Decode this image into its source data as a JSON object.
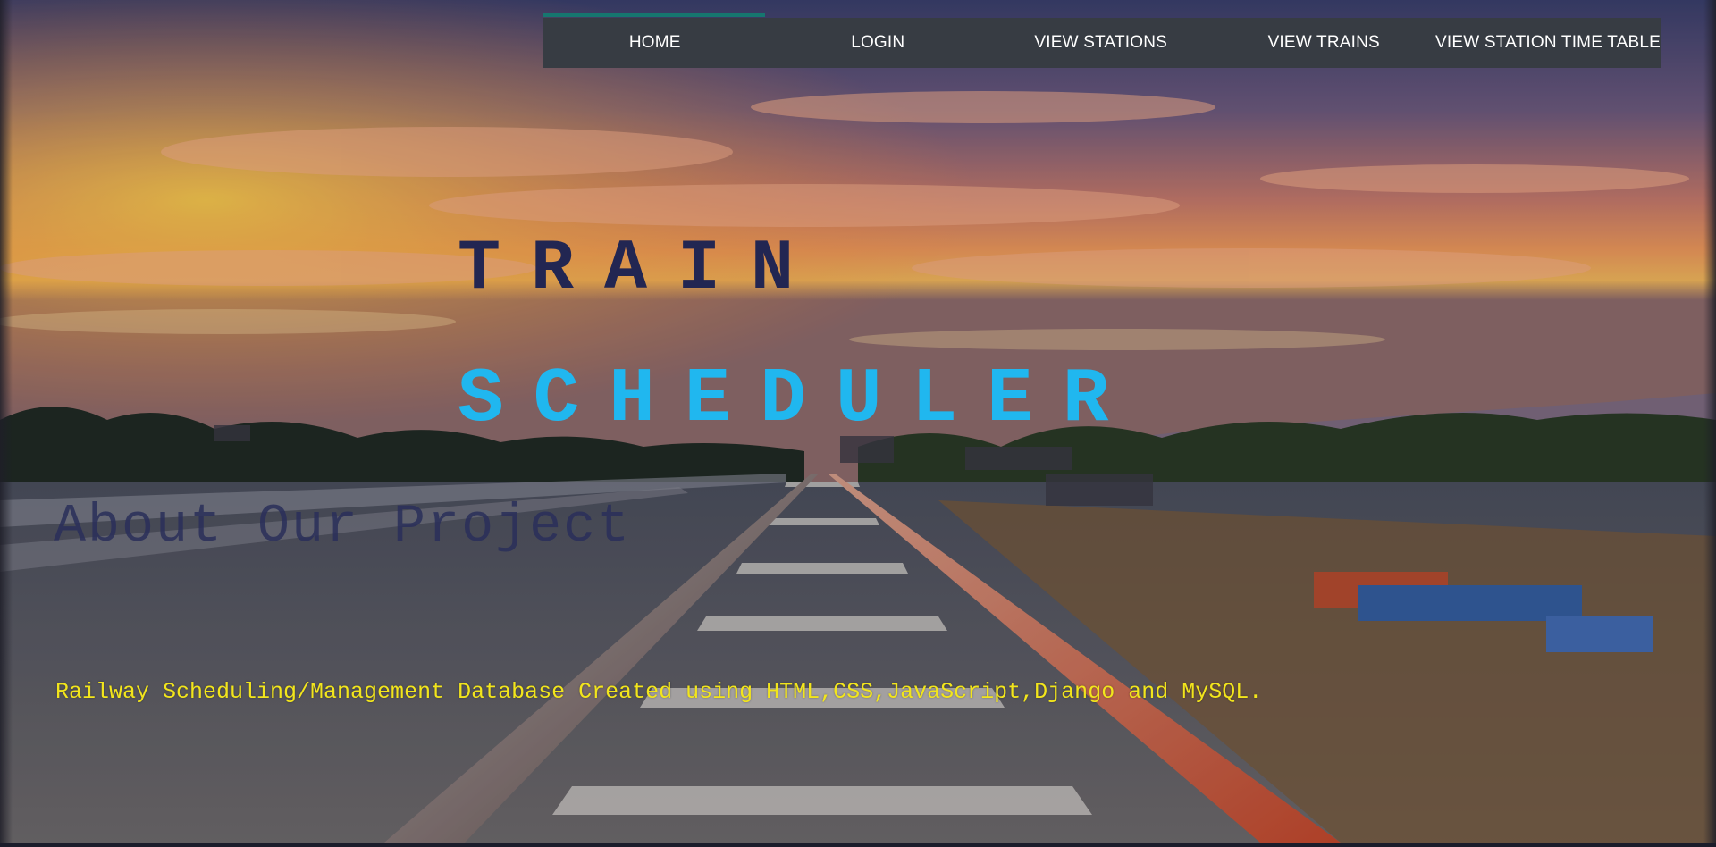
{
  "nav": {
    "items": [
      {
        "label": "HOME"
      },
      {
        "label": "LOGIN"
      },
      {
        "label": "VIEW STATIONS"
      },
      {
        "label": "VIEW TRAINS"
      },
      {
        "label": "VIEW STATION TIME TABLE"
      }
    ],
    "active_index": 0,
    "indicator_color": "#16766f",
    "background_color": "#373c43"
  },
  "hero": {
    "title_line1": "TRAIN",
    "title_line2": "SCHEDULER",
    "title_line1_color": "#222652",
    "title_line2_color": "#20b7ef",
    "about_heading": "About Our Project",
    "description": "Railway Scheduling/Management Database Created using HTML,CSS,JavaScript,Django and MySQL.",
    "description_color": "#f2e51c"
  },
  "background": {
    "subject": "railway tracks at sunset background photo"
  }
}
